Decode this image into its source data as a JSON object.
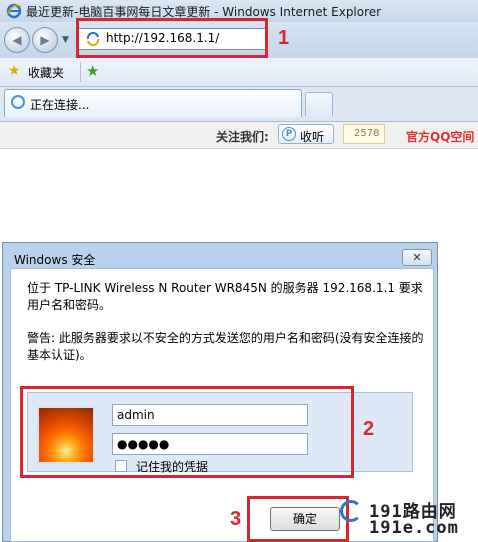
{
  "browser": {
    "window_title": "最近更新-电脑百事网每日文章更新 - Windows Internet Explorer",
    "address": "http://192.168.1.1/",
    "favorites_label": "收藏夹",
    "tab_label": "正在连接...",
    "follow_label": "关注我们:",
    "listen_label": "收听",
    "listen_count": "2578",
    "qq_label": "官方QQ空间"
  },
  "dialog": {
    "title": "Windows 安全",
    "close_label": "✕",
    "message": "位于 TP-LINK Wireless N Router WR845N 的服务器 192.168.1.1 要求用户名和密码。",
    "warning": "警告: 此服务器要求以不安全的方式发送您的用户名和密码(没有安全连接的基本认证)。",
    "username": "admin",
    "password_mask": "●●●●●",
    "remember_label": "记住我的凭据",
    "ok_label": "确定"
  },
  "callouts": [
    "1",
    "2",
    "3"
  ],
  "watermark": {
    "line1": "191路由网",
    "line2": "191e.com"
  },
  "colors": {
    "callout": "#d8262e",
    "accent": "#2a74c9"
  },
  "icons": [
    "ie-logo-icon",
    "back-arrow-icon",
    "forward-arrow-icon",
    "page-icon",
    "favorites-star-icon",
    "add-favorite-icon",
    "loading-icon",
    "listen-icon",
    "close-icon",
    "user-avatar-icon"
  ]
}
